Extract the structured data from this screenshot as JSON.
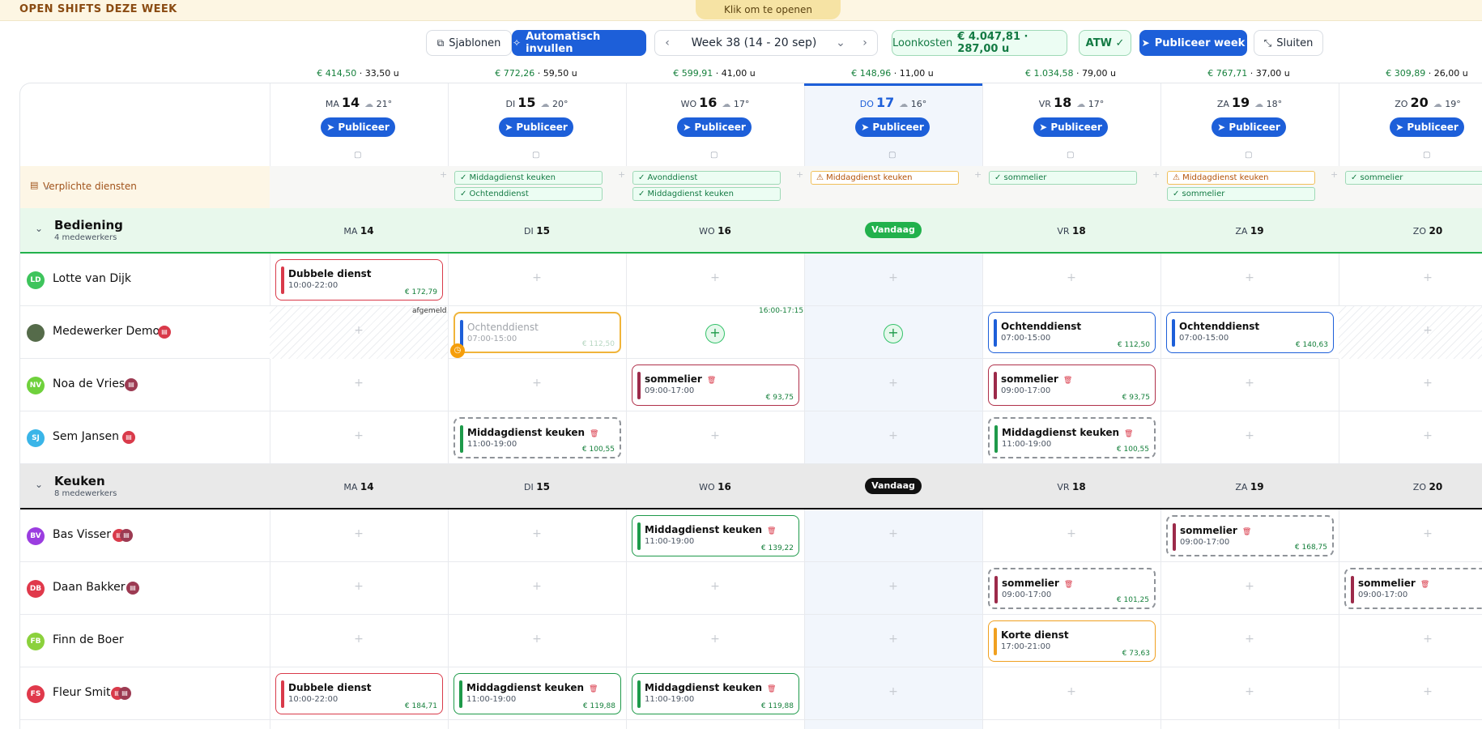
{
  "banner": {
    "title": "OPEN SHIFTS DEZE WEEK",
    "pill": "Klik om te openen"
  },
  "toolbar": {
    "templates": "Sjablonen",
    "autofill": "Automatisch invullen",
    "week": "Week 38 (14 - 20 sep)",
    "wage_label": "Loonkosten",
    "wage_value": "€ 4.047,81 · 287,00 u",
    "atw": "ATW ✓",
    "publish_week": "Publiceer week",
    "close": "Sluiten"
  },
  "days": [
    {
      "dow": "MA",
      "num": "14",
      "temp": "21°",
      "money": "€ 414,50",
      "hours": "33,50 u",
      "today": false
    },
    {
      "dow": "DI",
      "num": "15",
      "temp": "20°",
      "money": "€ 772,26",
      "hours": "59,50 u",
      "today": false
    },
    {
      "dow": "WO",
      "num": "16",
      "temp": "17°",
      "money": "€ 599,91",
      "hours": "41,00 u",
      "today": false
    },
    {
      "dow": "DO",
      "num": "17",
      "temp": "16°",
      "money": "€ 148,96",
      "hours": "11,00 u",
      "today": true
    },
    {
      "dow": "VR",
      "num": "18",
      "temp": "17°",
      "money": "€ 1.034,58",
      "hours": "79,00 u",
      "today": false
    },
    {
      "dow": "ZA",
      "num": "19",
      "temp": "18°",
      "money": "€ 767,71",
      "hours": "37,00 u",
      "today": false
    },
    {
      "dow": "ZO",
      "num": "20",
      "temp": "19°",
      "money": "€ 309,89",
      "hours": "26,00 u",
      "today": false
    }
  ],
  "publish_label": "Publiceer",
  "verplicht": {
    "label": "Verplichte diensten",
    "tags": [
      {
        "day": 1,
        "slot": 0,
        "text": "Middagdienst keuken",
        "warn": false
      },
      {
        "day": 1,
        "slot": 1,
        "text": "Ochtenddienst",
        "warn": false
      },
      {
        "day": 2,
        "slot": 0,
        "text": "Avonddienst",
        "warn": false
      },
      {
        "day": 2,
        "slot": 1,
        "text": "Middagdienst keuken",
        "warn": false
      },
      {
        "day": 3,
        "slot": 0,
        "text": "Middagdienst keuken",
        "warn": true
      },
      {
        "day": 4,
        "slot": 0,
        "text": "sommelier",
        "warn": false
      },
      {
        "day": 5,
        "slot": 0,
        "text": "Middagdienst keuken",
        "warn": true
      },
      {
        "day": 5,
        "slot": 1,
        "text": "sommelier",
        "warn": false
      },
      {
        "day": 6,
        "slot": 0,
        "text": "sommelier",
        "warn": false
      }
    ]
  },
  "today_label": "Vandaag",
  "groups": [
    {
      "name": "Bediening",
      "sub": "4 medewerkers",
      "style": "b",
      "employees": [
        {
          "initials": "LD",
          "name": "Lotte van Dijk",
          "color": "#3ec45c",
          "badges": [],
          "photo": false,
          "cells": [
            {
              "day": 0,
              "title": "Dubbele dienst",
              "time": "10:00-22:00",
              "price": "€ 172,79",
              "style": "red"
            }
          ]
        },
        {
          "initials": "",
          "name": "Medewerker Demo",
          "color": "#556b4a",
          "badges": [
            "red"
          ],
          "photo": true,
          "hatch": [
            0,
            6
          ],
          "add": [
            2,
            3
          ],
          "note_afgemeld": "afgemeld",
          "note_time": "16:00-17:15",
          "cells": [
            {
              "day": 1,
              "title": "Ochtenddienst",
              "time": "07:00-15:00",
              "price": "€ 112,50",
              "style": "faded"
            },
            {
              "day": 4,
              "title": "Ochtenddienst",
              "time": "07:00-15:00",
              "price": "€ 112,50",
              "style": "blue"
            },
            {
              "day": 5,
              "title": "Ochtenddienst",
              "time": "07:00-15:00",
              "price": "€ 140,63",
              "style": "blue"
            }
          ]
        },
        {
          "initials": "NV",
          "name": "Noa de Vries",
          "color": "#6fd13c",
          "badges": [
            "dk"
          ],
          "photo": false,
          "cells": [
            {
              "day": 2,
              "title": "sommelier",
              "time": "09:00-17:00",
              "price": "€ 93,75",
              "style": "wine",
              "trash": true
            },
            {
              "day": 4,
              "title": "sommelier",
              "time": "09:00-17:00",
              "price": "€ 93,75",
              "style": "wine",
              "trash": true
            }
          ]
        },
        {
          "initials": "SJ",
          "name": "Sem Jansen",
          "color": "#3ab5e8",
          "badges": [
            "red"
          ],
          "photo": false,
          "cells": [
            {
              "day": 1,
              "title": "Middagdienst keuken",
              "time": "11:00-19:00",
              "price": "€ 100,55",
              "style": "dash green",
              "trash": true
            },
            {
              "day": 4,
              "title": "Middagdienst keuken",
              "time": "11:00-19:00",
              "price": "€ 100,55",
              "style": "dash green",
              "trash": true
            }
          ]
        }
      ]
    },
    {
      "name": "Keuken",
      "sub": "8 medewerkers",
      "style": "k",
      "employees": [
        {
          "initials": "BV",
          "name": "Bas Visser",
          "color": "#9b3de0",
          "badges": [
            "red",
            "dk"
          ],
          "photo": false,
          "cells": [
            {
              "day": 2,
              "title": "Middagdienst keuken",
              "time": "11:00-19:00",
              "price": "€ 139,22",
              "style": "green",
              "trash": true
            },
            {
              "day": 5,
              "title": "sommelier",
              "time": "09:00-17:00",
              "price": "€ 168,75",
              "style": "dash wine",
              "trash": true
            }
          ]
        },
        {
          "initials": "DB",
          "name": "Daan Bakker",
          "color": "#e0394b",
          "badges": [
            "dk"
          ],
          "photo": false,
          "cells": [
            {
              "day": 4,
              "title": "sommelier",
              "time": "09:00-17:00",
              "price": "€ 101,25",
              "style": "dash wine",
              "trash": true
            },
            {
              "day": 6,
              "title": "sommelier",
              "time": "09:00-17:00",
              "price": "€",
              "style": "dash wine",
              "trash": true
            }
          ]
        },
        {
          "initials": "FB",
          "name": "Finn de Boer",
          "color": "#8bd13c",
          "badges": [],
          "photo": false,
          "cells": [
            {
              "day": 4,
              "title": "Korte dienst",
              "time": "17:00-21:00",
              "price": "€ 73,63",
              "style": "orange"
            }
          ]
        },
        {
          "initials": "FS",
          "name": "Fleur Smit",
          "color": "#e0394b",
          "badges": [
            "red",
            "dk"
          ],
          "photo": false,
          "cells": [
            {
              "day": 0,
              "title": "Dubbele dienst",
              "time": "10:00-22:00",
              "price": "€ 184,71",
              "style": "red"
            },
            {
              "day": 1,
              "title": "Middagdienst keuken",
              "time": "11:00-19:00",
              "price": "€ 119,88",
              "style": "green",
              "trash": true
            },
            {
              "day": 2,
              "title": "Middagdienst keuken",
              "time": "11:00-19:00",
              "price": "€ 119,88",
              "style": "green",
              "trash": true
            }
          ]
        }
      ]
    }
  ]
}
